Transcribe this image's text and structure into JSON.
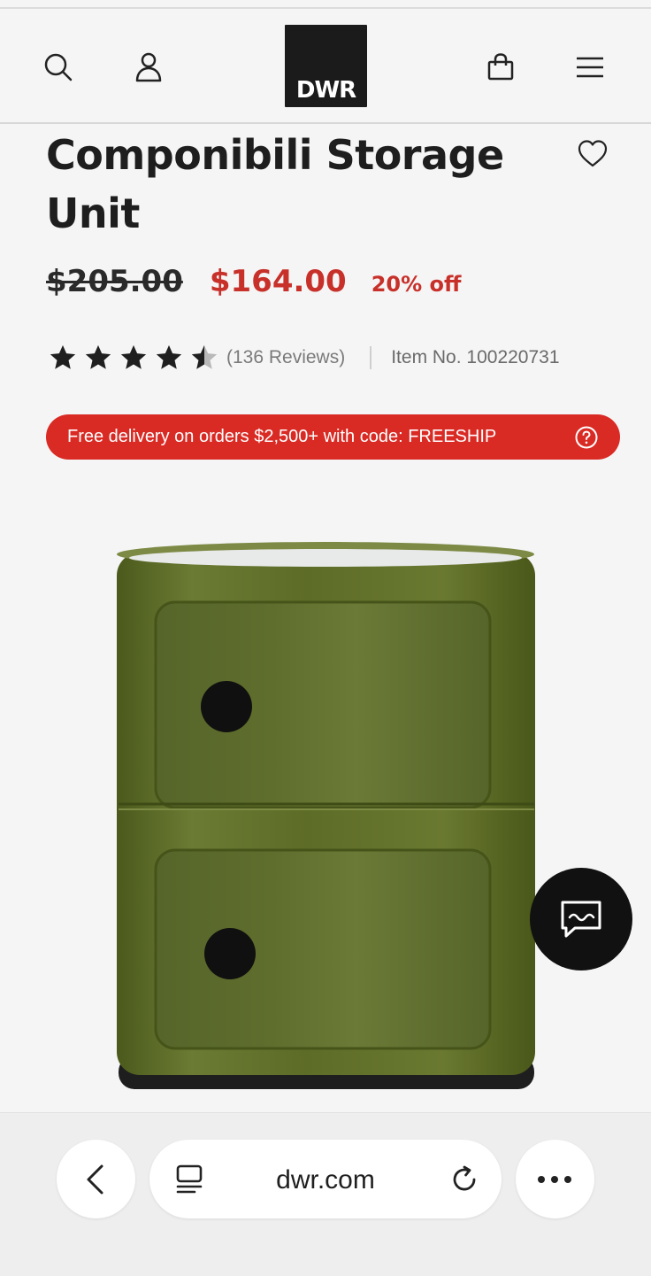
{
  "header": {
    "logo_text": "DWR",
    "icons": [
      "search-icon",
      "account-icon",
      "bag-icon",
      "menu-icon"
    ]
  },
  "product": {
    "title": "Componibili Storage Unit",
    "original_price": "$205.00",
    "sale_price": "$164.00",
    "discount": "20% off",
    "rating": 4.5,
    "rating_max": 5,
    "reviews": "(136 Reviews)",
    "item_number": "Item No. 100220731"
  },
  "promo": {
    "text": "Free delivery on orders $2,500+ with code: FREESHIP",
    "icon": "help-icon"
  },
  "chat": {
    "icon": "chat-icon"
  },
  "browser": {
    "url": "dwr.com",
    "icons": [
      "back-icon",
      "tabs-icon",
      "reload-icon",
      "more-icon"
    ]
  },
  "colors": {
    "accent_red": "#d92a24",
    "price_red": "#c8302a",
    "logo_black": "#1b1b1b",
    "product_green": "#5e6c2a"
  }
}
